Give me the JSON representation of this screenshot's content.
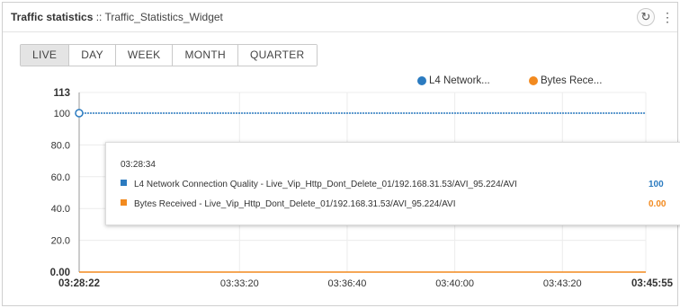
{
  "widget": {
    "title_main": "Traffic statistics",
    "title_separator": " :: ",
    "title_sub": "Traffic_Statistics_Widget",
    "refresh_icon": "refresh-icon",
    "menu_icon": "kebab-menu-icon"
  },
  "tabs": [
    {
      "label": "LIVE",
      "active": true
    },
    {
      "label": "DAY",
      "active": false
    },
    {
      "label": "WEEK",
      "active": false
    },
    {
      "label": "MONTH",
      "active": false
    },
    {
      "label": "QUARTER",
      "active": false
    }
  ],
  "legend": [
    {
      "label": "L4 Network...",
      "color": "#2b7bc0"
    },
    {
      "label": "Bytes Rece...",
      "color": "#f28a1f"
    }
  ],
  "tooltip": {
    "time": "03:28:34",
    "rows": [
      {
        "label": "L4 Network Connection Quality - Live_Vip_Http_Dont_Delete_01/192.168.31.53/AVI_95.224/AVI",
        "value": "100",
        "color": "#2b7bc0"
      },
      {
        "label": "Bytes Received - Live_Vip_Http_Dont_Delete_01/192.168.31.53/AVI_95.224/AVI",
        "value": "0.00",
        "color": "#f28a1f"
      }
    ]
  },
  "chart_data": {
    "type": "line",
    "y_ticks": [
      "0.00",
      "20.0",
      "40.0",
      "60.0",
      "80.0",
      "100",
      "113"
    ],
    "ylim": [
      0,
      113
    ],
    "x_ticks": [
      "03:28:22",
      "03:33:20",
      "03:36:40",
      "03:40:00",
      "03:43:20",
      "03:45:55"
    ],
    "x_start": "03:28:22",
    "x_end": "03:45:55",
    "series": [
      {
        "name": "L4 Network Connection Quality",
        "color": "#2b7bc0",
        "x": [
          "03:28:22",
          "03:45:55"
        ],
        "values": [
          100,
          100
        ]
      },
      {
        "name": "Bytes Received",
        "color": "#f28a1f",
        "x": [
          "03:28:22",
          "03:45:55"
        ],
        "values": [
          0,
          0
        ]
      }
    ],
    "grid": true
  }
}
